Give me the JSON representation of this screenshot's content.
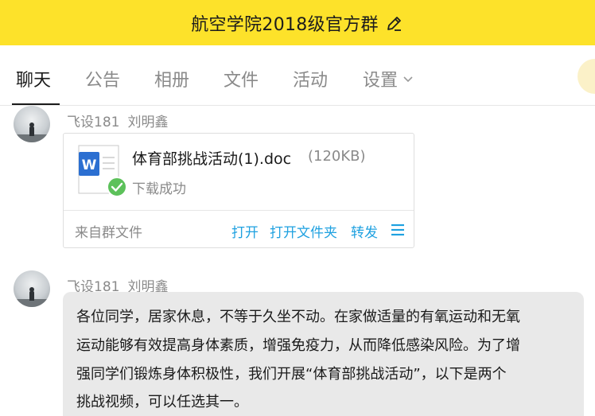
{
  "header": {
    "title": "航空学院2018级官方群",
    "edit_icon": "pencil-icon"
  },
  "tabs": [
    {
      "label": "聊天",
      "active": true
    },
    {
      "label": "公告",
      "active": false
    },
    {
      "label": "相册",
      "active": false
    },
    {
      "label": "文件",
      "active": false
    },
    {
      "label": "活动",
      "active": false
    },
    {
      "label": "设置",
      "active": false
    }
  ],
  "messages": [
    {
      "sender_class": "飞设181",
      "sender_name": "刘明鑫",
      "file": {
        "icon": "word-doc-icon",
        "name": "体育部挑战活动(1).doc",
        "size": "(120KB)",
        "status": "下载成功",
        "source": "来自群文件",
        "actions": [
          "打开",
          "打开文件夹",
          "转发"
        ],
        "menu_icon": "menu-icon"
      }
    },
    {
      "sender_class": "飞设181",
      "sender_name": "刘明鑫",
      "text_lines": [
        "各位同学，居家休息，不等于久坐不动。在家做适量的有氧运动和无氧",
        "运动能够有效提高身体素质，增强免疫力，从而降低感染风险。为了增",
        "强同学们锻炼身体积极性，我们开展“体育部挑战活动”，以下是两个",
        "挑战视频，可以任选其一。"
      ]
    }
  ],
  "colors": {
    "header_bg": "#fde22a",
    "link_blue": "#1fa1e0",
    "bubble_bg": "#e9e9e9",
    "success_green": "#5cc15a"
  }
}
